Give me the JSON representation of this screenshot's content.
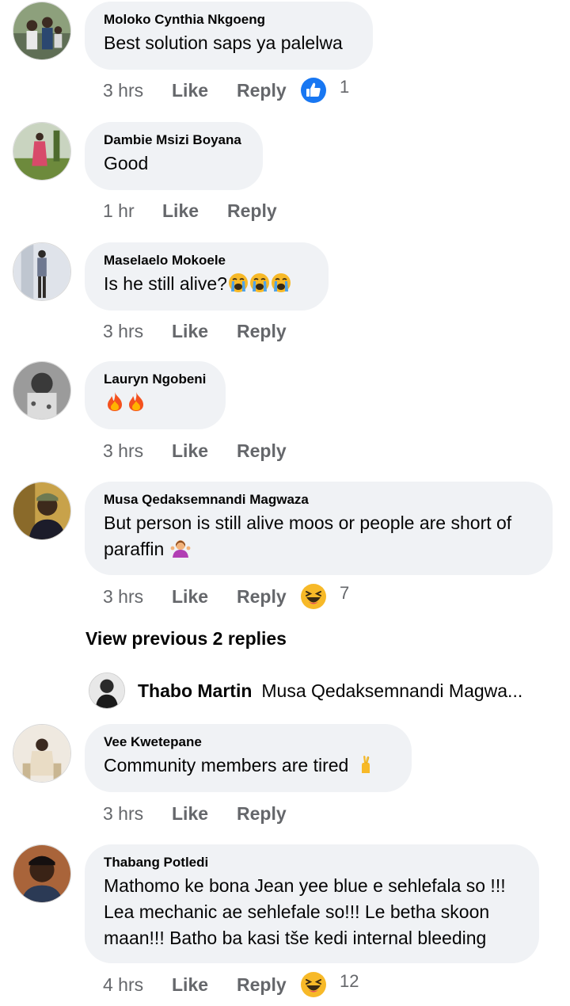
{
  "comments": [
    {
      "author": "Moloko Cynthia Nkgoeng",
      "text": "Best solution saps ya palelwa",
      "time": "3 hrs",
      "like_label": "Like",
      "reply_label": "Reply",
      "reaction": {
        "icon": "thumbs-up-icon",
        "count": "1",
        "color": "#1877f2"
      }
    },
    {
      "author": "Dambie Msizi Boyana",
      "text": "Good",
      "time": "1 hr",
      "like_label": "Like",
      "reply_label": "Reply"
    },
    {
      "author": "Maselaelo Mokoele",
      "text": "Is he still alive?",
      "emojis": [
        "crying-face-emoji",
        "crying-face-emoji",
        "crying-face-emoji"
      ],
      "time": "3 hrs",
      "like_label": "Like",
      "reply_label": "Reply"
    },
    {
      "author": "Lauryn Ngobeni",
      "text": "",
      "emojis": [
        "fire-emoji",
        "fire-emoji"
      ],
      "time": "3 hrs",
      "like_label": "Like",
      "reply_label": "Reply"
    },
    {
      "author": "Musa Qedaksemnandi Magwaza",
      "text_line1": "But person is still alive moos or people are short of",
      "text_line2": "paraffin",
      "emojis": [
        "person-shrugging-emoji"
      ],
      "time": "3 hrs",
      "like_label": "Like",
      "reply_label": "Reply",
      "reaction": {
        "icon": "laughing-face-icon",
        "count": "7"
      }
    },
    {
      "author": "Vee Kwetepane",
      "text": "Community members are tired",
      "emojis": [
        "crossed-fingers-emoji"
      ],
      "time": "3 hrs",
      "like_label": "Like",
      "reply_label": "Reply"
    },
    {
      "author": "Thabang Potledi",
      "text_line1": "Mathomo ke bona Jean yee blue e sehlefala so !!!",
      "text_line2": "Lea mechanic ae sehlefale so!!! Le betha skoon",
      "text_line3": "maan!!! Batho ba kasi tše kedi internal bleeding",
      "time": "4 hrs",
      "like_label": "Like",
      "reply_label": "Reply",
      "reaction": {
        "icon": "laughing-face-icon",
        "count": "12"
      }
    }
  ],
  "view_previous": "View previous 2 replies",
  "reply_preview": {
    "author": "Thabo Martin",
    "text": "Musa Qedaksemnandi Magwa..."
  }
}
